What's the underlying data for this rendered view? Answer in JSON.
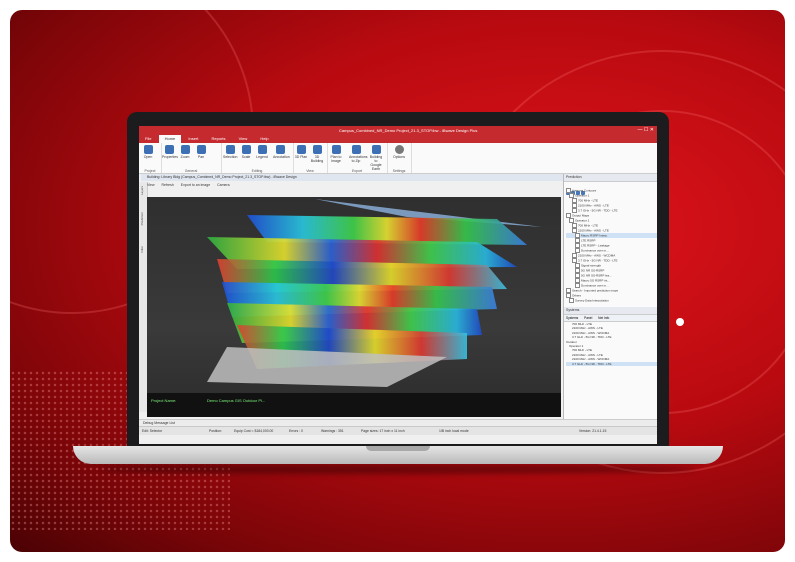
{
  "app": {
    "title": "Campus_Combined_NR_Demo Project_21.3_STOP.ibw - iBwave Design Plus",
    "window_buttons": "—  ☐  ✕"
  },
  "menu": {
    "tabs": [
      "File",
      "Home",
      "Insert",
      "Reports",
      "View",
      "Help"
    ],
    "active": "Home"
  },
  "ribbon": {
    "groups": [
      {
        "label": "Project",
        "buttons": [
          "Open",
          "Close"
        ]
      },
      {
        "label": "General",
        "buttons": [
          "Properties",
          "Zoom",
          "Pan",
          "Find",
          "FOVs"
        ]
      },
      {
        "label": "Editing",
        "buttons": [
          "Selection",
          "Scale",
          "Legend",
          "Annotation"
        ]
      },
      {
        "label": "View",
        "buttons": [
          "3D Plan",
          "3D Building"
        ]
      },
      {
        "label": "Export",
        "buttons": [
          "Plan to Image",
          "Annotations to Zip",
          "Building to Google Earth"
        ]
      },
      {
        "label": "Settings",
        "buttons": [
          "Options"
        ]
      }
    ]
  },
  "document_tab": "Building: Library Bldg (Campus_Combined_NR_Demo Project_21.3_STOP.ibw) - iBwave Design",
  "viewbar": [
    "View",
    "Refresh",
    "Export to an image",
    "Camera"
  ],
  "sidestrip": [
    "Layers",
    "Prediction",
    "Filter"
  ],
  "viewport": {
    "info_label": "Project Name:",
    "info_value": "Demo Campus GIS Outdoor Pl..."
  },
  "prediction_panel": {
    "title": "Prediction",
    "tree": [
      "Antenna Contours",
      "Operator 1",
      "700 MHz - LTE",
      "2100 MHz - AWS - LTE",
      "3.7 GHz - 5G NR - TDD - LTE",
      "Output Maps",
      "Operator 1",
      "700 MHz - LTE",
      "2100 MHz - AWS - LTE",
      "Macro RSRP Interp.",
      "LTE RSRP",
      "LTE RSRP - Leakage",
      "Dominance over m...",
      "2100 MHz - AWS - WCDMA",
      "3.7 GHz - 5G NR - TDD - LTE",
      "Signal strength",
      "5G NR SS-RSRP",
      "5G NR SS-RSRP lea...",
      "Macro 5G RSRP int...",
      "Dominance over m...",
      "Search - Imported prediction maps",
      "Others",
      "Survey Data Interpolation"
    ],
    "selected_index": 9
  },
  "systems_panel": {
    "title": "Systems",
    "tabs": [
      "Systems",
      "Panel",
      "Net Info"
    ],
    "tree": [
      "700 MHz - LTE",
      "2100 MHz - AWS - LTE",
      "2100 MHz - AWS - WCDMA",
      "3.7 GHz - 5G NR - TDD - LTE",
      "Outdoor",
      "Operator 1",
      "700 MHz - LTE",
      "2100 MHz - AWS - LTE",
      "2100 MHz - AWS - WCDMA",
      "3.7 GHz - 5G NR - TDD - LTE"
    ]
  },
  "message_bar": "Debug Message List",
  "status": {
    "mode": "Edit: Selector",
    "position": "Position:",
    "cost": "Equip Cost = $184,000.00",
    "errors": "Errors : 0",
    "warnings": "Warnings : 351",
    "page": "Page sizes: 17 inch x 11 inch",
    "units": "1IB inch local mode",
    "version": "Version: 21.4.1.15"
  },
  "colors": {
    "accent": "#c52a2f",
    "background_red": "#d0111a"
  }
}
